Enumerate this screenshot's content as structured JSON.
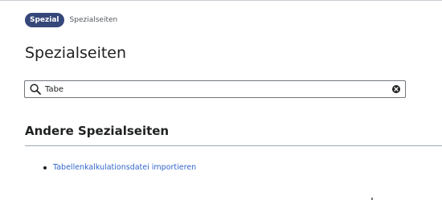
{
  "breadcrumb": {
    "badge_label": "Spezial",
    "current": "Spezialseiten"
  },
  "page_title": "Spezialseiten",
  "search": {
    "value": "Tabe",
    "placeholder": ""
  },
  "section": {
    "heading": "Andere Spezialseiten",
    "links": [
      {
        "label": "Tabellenkalkulationsdatei importieren"
      }
    ]
  },
  "colors": {
    "badge_bg": "#36477a",
    "link": "#3366cc",
    "text": "#202122"
  },
  "icons": {
    "search": "search-icon",
    "clear": "clear-icon"
  }
}
